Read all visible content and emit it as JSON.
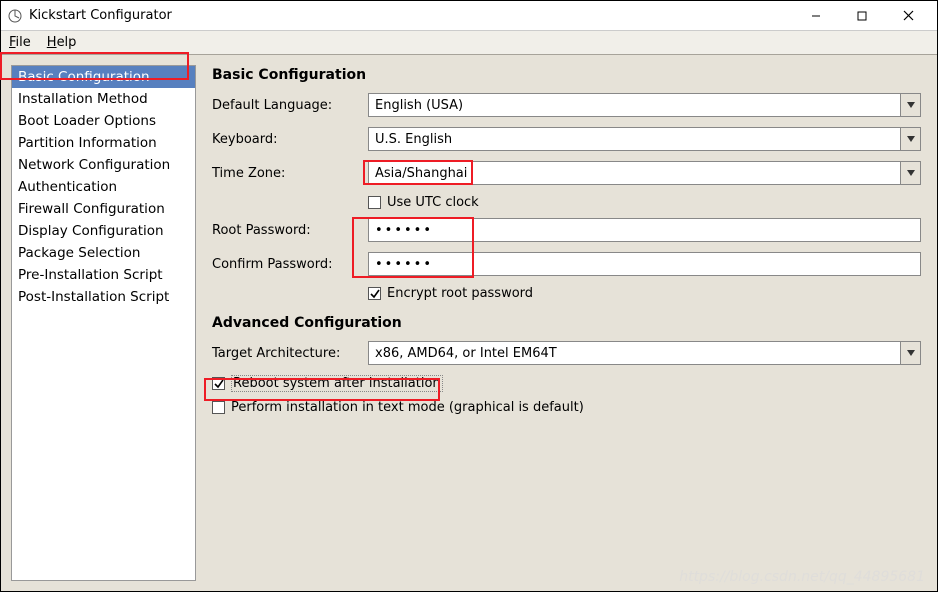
{
  "window": {
    "title": "Kickstart Configurator"
  },
  "menubar": {
    "file": "File",
    "help": "Help"
  },
  "sidebar": {
    "items": [
      "Basic Configuration",
      "Installation Method",
      "Boot Loader Options",
      "Partition Information",
      "Network Configuration",
      "Authentication",
      "Firewall Configuration",
      "Display Configuration",
      "Package Selection",
      "Pre-Installation Script",
      "Post-Installation Script"
    ],
    "selectedIndex": 0
  },
  "basic": {
    "title": "Basic Configuration",
    "labels": {
      "defaultLanguage": "Default Language:",
      "keyboard": "Keyboard:",
      "timeZone": "Time Zone:",
      "rootPassword": "Root Password:",
      "confirmPassword": "Confirm Password:"
    },
    "values": {
      "defaultLanguage": "English (USA)",
      "keyboard": "U.S. English",
      "timeZone": "Asia/Shanghai",
      "rootPassword": "••••••",
      "confirmPassword": "••••••"
    },
    "checkboxes": {
      "useUtc": {
        "label": "Use UTC clock",
        "checked": false
      },
      "encrypt": {
        "label": "Encrypt root password",
        "checked": true
      }
    }
  },
  "advanced": {
    "title": "Advanced Configuration",
    "labels": {
      "targetArch": "Target Architecture:"
    },
    "values": {
      "targetArch": "x86, AMD64, or Intel EM64T"
    },
    "checkboxes": {
      "reboot": {
        "label": "Reboot system after installation",
        "checked": true
      },
      "textmode": {
        "label": "Perform installation in text mode (graphical is default)",
        "checked": false
      }
    }
  },
  "watermark": "https://blog.csdn.net/qq_44895681"
}
